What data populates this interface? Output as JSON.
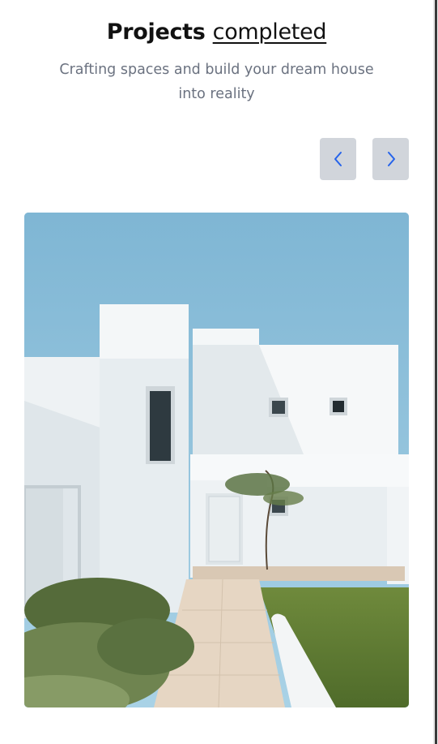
{
  "section": {
    "title_bold": "Projects",
    "title_underlined": "completed",
    "subtitle_line1": "Crafting spaces and build your dream house",
    "subtitle_line2": "into reality"
  },
  "carousel": {
    "prev_icon": "chevron-left-icon",
    "next_icon": "chevron-right-icon",
    "image_alt": "White modern house with path and garden",
    "accent_color": "#2563eb",
    "button_color": "#d1d5db"
  }
}
